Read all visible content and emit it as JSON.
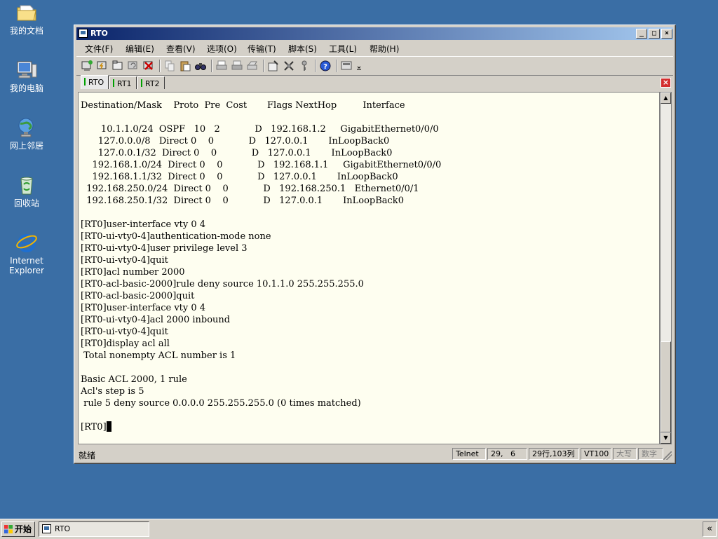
{
  "desktop": {
    "icons": [
      {
        "label": "我的文档",
        "icon": "folder-icon"
      },
      {
        "label": "我的电脑",
        "icon": "computer-icon"
      },
      {
        "label": "网上邻居",
        "icon": "network-icon"
      },
      {
        "label": "回收站",
        "icon": "recycle-bin-icon"
      },
      {
        "label": "Internet",
        "label2": "Explorer",
        "icon": "ie-icon"
      }
    ]
  },
  "window": {
    "title": "RTO",
    "controls": {
      "minimize": "_",
      "maximize": "□",
      "close": "×"
    },
    "menu": [
      "文件(F)",
      "编辑(E)",
      "查看(V)",
      "选项(O)",
      "传输(T)",
      "脚本(S)",
      "工具(L)",
      "帮助(H)"
    ],
    "tabs": [
      {
        "label": "RTO",
        "active": true
      },
      {
        "label": "RT1",
        "active": false
      },
      {
        "label": "RT2",
        "active": false
      }
    ],
    "tab_close": "×"
  },
  "terminal": {
    "lines": [
      "Destination/Mask    Proto  Pre  Cost       Flags NextHop         Interface",
      "",
      "       10.1.1.0/24  OSPF   10   2            D   192.168.1.2     GigabitEthernet0/0/0",
      "      127.0.0.0/8   Direct 0    0            D   127.0.0.1       InLoopBack0",
      "      127.0.0.1/32  Direct 0    0            D   127.0.0.1       InLoopBack0",
      "    192.168.1.0/24  Direct 0    0            D   192.168.1.1     GigabitEthernet0/0/0",
      "    192.168.1.1/32  Direct 0    0            D   127.0.0.1       InLoopBack0",
      "  192.168.250.0/24  Direct 0    0            D   192.168.250.1   Ethernet0/0/1",
      "  192.168.250.1/32  Direct 0    0            D   127.0.0.1       InLoopBack0",
      "",
      "[RT0]user-interface vty 0 4",
      "[RT0-ui-vty0-4]authentication-mode none",
      "[RT0-ui-vty0-4]user privilege level 3",
      "[RT0-ui-vty0-4]quit",
      "[RT0]acl number 2000",
      "[RT0-acl-basic-2000]rule deny source 10.1.1.0 255.255.255.0",
      "[RT0-acl-basic-2000]quit",
      "[RT0]user-interface vty 0 4",
      "[RT0-ui-vty0-4]acl 2000 inbound",
      "[RT0-ui-vty0-4]quit",
      "[RT0]display acl all",
      " Total nonempty ACL number is 1",
      "",
      "Basic ACL 2000, 1 rule",
      "Acl's step is 5",
      " rule 5 deny source 0.0.0.0 255.255.255.0 (0 times matched)",
      ""
    ],
    "prompt": "[RT0]"
  },
  "statusbar": {
    "ready": "就绪",
    "protocol": "Telnet",
    "position": "29,   6",
    "rowcol": "29行,103列",
    "emulation": "VT100",
    "caps": "大写",
    "num": "数字"
  },
  "taskbar": {
    "start": "开始",
    "task": "RTO",
    "tray": "«"
  }
}
